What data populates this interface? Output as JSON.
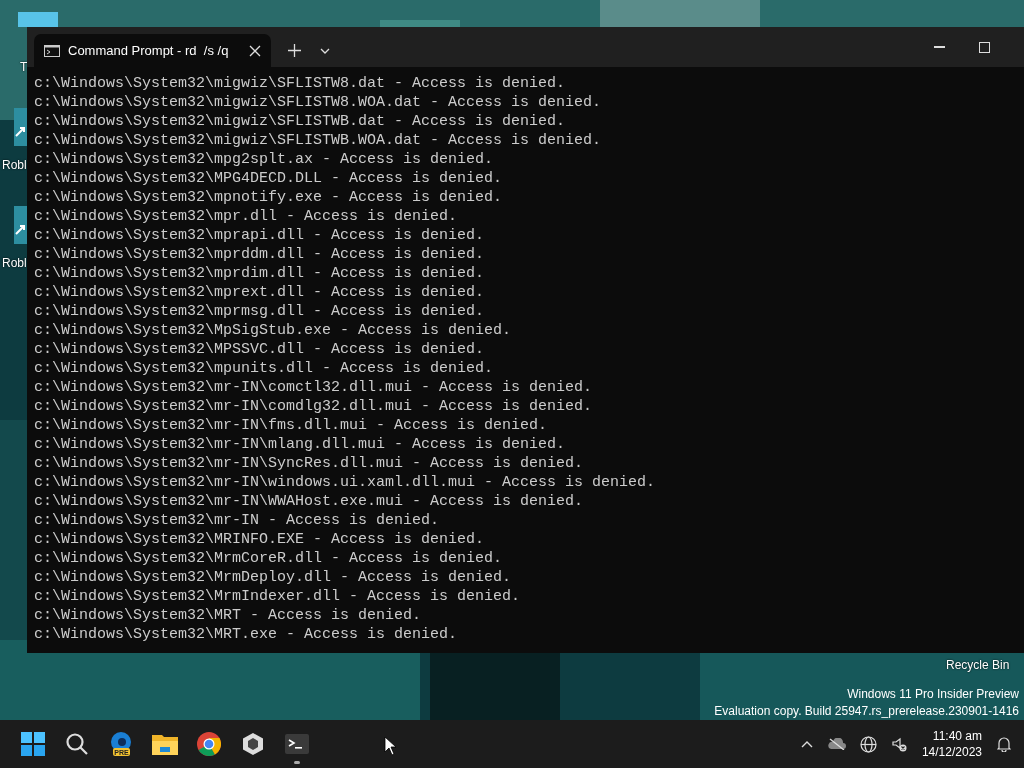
{
  "desktop": {
    "icons": [
      {
        "label": "T"
      },
      {
        "label": "Robl"
      },
      {
        "label": "Robl"
      },
      {
        "label": "Recycle Bin"
      }
    ],
    "watermark": [
      "Windows 11 Pro Insider Preview",
      "Evaluation copy. Build 25947.rs_prerelease.230901-1416"
    ]
  },
  "window": {
    "tab": {
      "title": "Command Prompt - rd  /s /q",
      "selected": true
    },
    "lines": [
      "c:\\Windows\\System32\\migwiz\\SFLISTW8.dat - Access is denied.",
      "c:\\Windows\\System32\\migwiz\\SFLISTW8.WOA.dat - Access is denied.",
      "c:\\Windows\\System32\\migwiz\\SFLISTWB.dat - Access is denied.",
      "c:\\Windows\\System32\\migwiz\\SFLISTWB.WOA.dat - Access is denied.",
      "c:\\Windows\\System32\\mpg2splt.ax - Access is denied.",
      "c:\\Windows\\System32\\MPG4DECD.DLL - Access is denied.",
      "c:\\Windows\\System32\\mpnotify.exe - Access is denied.",
      "c:\\Windows\\System32\\mpr.dll - Access is denied.",
      "c:\\Windows\\System32\\mprapi.dll - Access is denied.",
      "c:\\Windows\\System32\\mprddm.dll - Access is denied.",
      "c:\\Windows\\System32\\mprdim.dll - Access is denied.",
      "c:\\Windows\\System32\\mprext.dll - Access is denied.",
      "c:\\Windows\\System32\\mprmsg.dll - Access is denied.",
      "c:\\Windows\\System32\\MpSigStub.exe - Access is denied.",
      "c:\\Windows\\System32\\MPSSVC.dll - Access is denied.",
      "c:\\Windows\\System32\\mpunits.dll - Access is denied.",
      "c:\\Windows\\System32\\mr-IN\\comctl32.dll.mui - Access is denied.",
      "c:\\Windows\\System32\\mr-IN\\comdlg32.dll.mui - Access is denied.",
      "c:\\Windows\\System32\\mr-IN\\fms.dll.mui - Access is denied.",
      "c:\\Windows\\System32\\mr-IN\\mlang.dll.mui - Access is denied.",
      "c:\\Windows\\System32\\mr-IN\\SyncRes.dll.mui - Access is denied.",
      "c:\\Windows\\System32\\mr-IN\\windows.ui.xaml.dll.mui - Access is denied.",
      "c:\\Windows\\System32\\mr-IN\\WWAHost.exe.mui - Access is denied.",
      "c:\\Windows\\System32\\mr-IN - Access is denied.",
      "c:\\Windows\\System32\\MRINFO.EXE - Access is denied.",
      "c:\\Windows\\System32\\MrmCoreR.dll - Access is denied.",
      "c:\\Windows\\System32\\MrmDeploy.dll - Access is denied.",
      "c:\\Windows\\System32\\MrmIndexer.dll - Access is denied.",
      "c:\\Windows\\System32\\MRT - Access is denied.",
      "c:\\Windows\\System32\\MRT.exe - Access is denied."
    ]
  },
  "taskbar": {
    "apps": [
      {
        "kind": "start",
        "running": false
      },
      {
        "kind": "search",
        "running": false
      },
      {
        "kind": "browser",
        "badge": "PRE",
        "running": false
      },
      {
        "kind": "folder",
        "running": false
      },
      {
        "kind": "chrome",
        "running": false
      },
      {
        "kind": "cube",
        "running": false
      },
      {
        "kind": "terminal",
        "running": true
      }
    ],
    "time": "11:40 am",
    "date": "14/12/2023"
  }
}
